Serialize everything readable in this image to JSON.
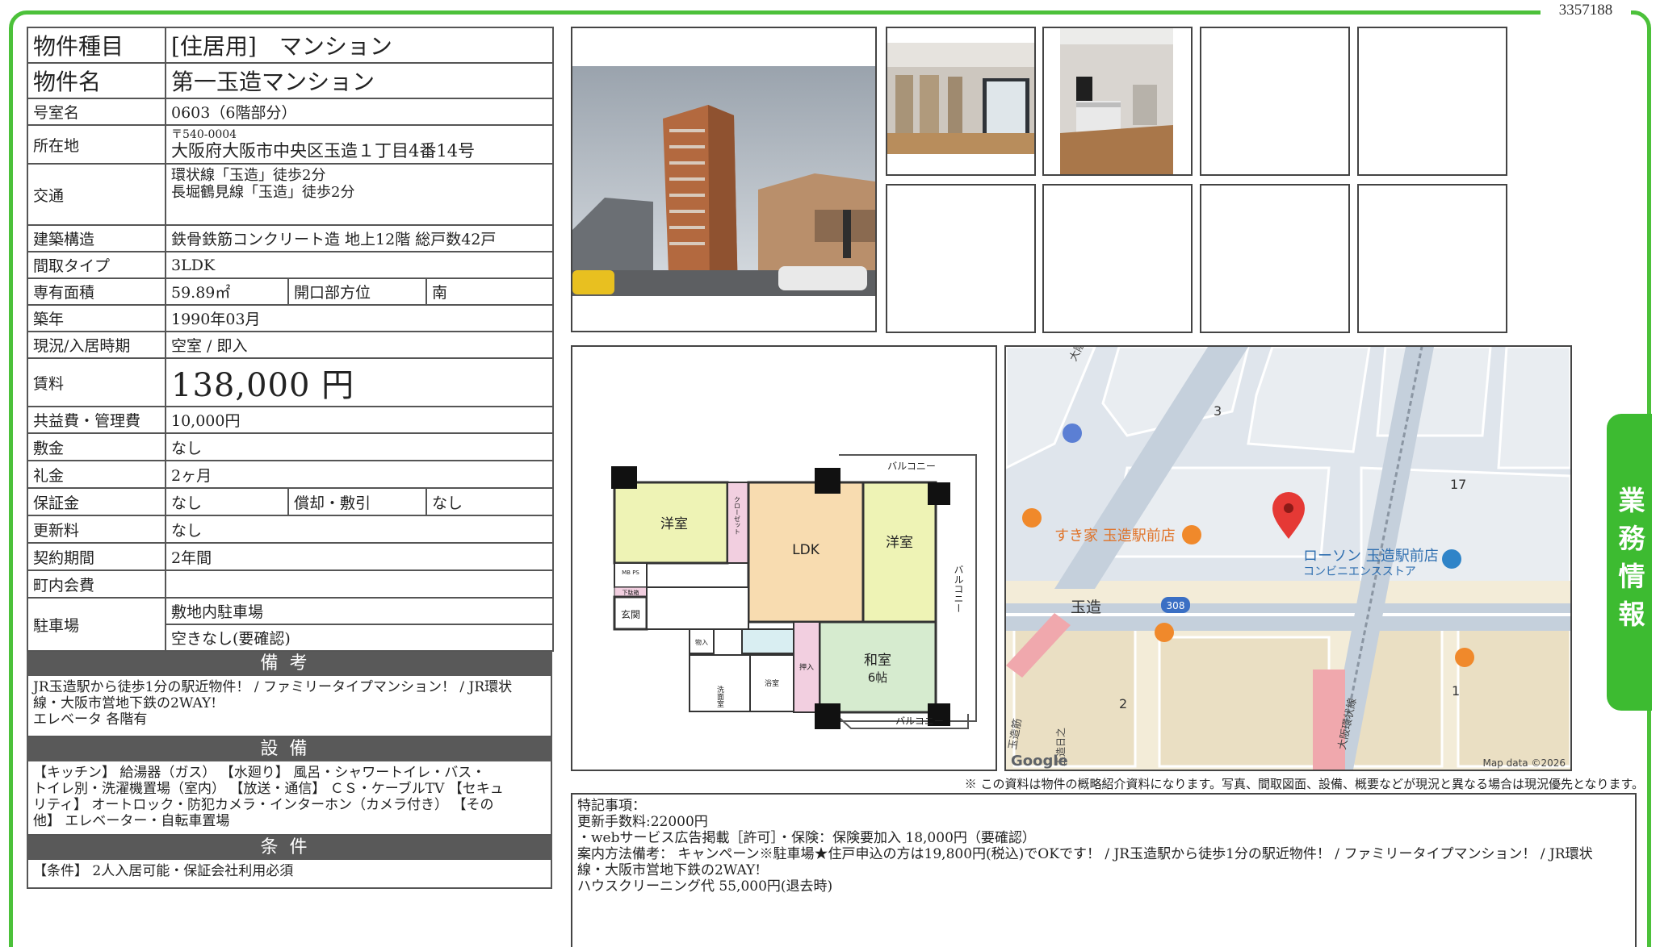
{
  "doc_id": "3357188",
  "side_tab": "業務情報",
  "property": {
    "type_label": "物件種目",
    "type_value": "[住居用]　マンション",
    "name_label": "物件名",
    "name_value": "第一玉造マンション",
    "room_label": "号室名",
    "room_value": "0603（6階部分）",
    "address_label": "所在地",
    "zip": "〒540-0004",
    "address": "大阪府大阪市中央区玉造１丁目4番14号",
    "transport_label": "交通",
    "transport_1": "環状線「玉造」徒歩2分",
    "transport_2": "長堀鶴見線「玉造」徒歩2分",
    "structure_label": "建築構造",
    "structure_value": "鉄骨鉄筋コンクリート造 地上12階 総戸数42戸",
    "layout_label": "間取タイプ",
    "layout_value": "3LDK",
    "area_label": "専有面積",
    "area_value": "59.89㎡",
    "direction_label": "開口部方位",
    "direction_value": "南",
    "built_label": "築年",
    "built_value": "1990年03月",
    "status_label": "現況/入居時期",
    "status_value": "空室 / 即入",
    "rent_label": "賃料",
    "rent_value": "138,000 円",
    "fee_label": "共益費・管理費",
    "fee_value": "10,000円",
    "deposit_label": "敷金",
    "deposit_value": "なし",
    "key_money_label": "礼金",
    "key_money_value": "2ヶ月",
    "guarantee_label": "保証金",
    "guarantee_value": "なし",
    "amortization_label": "償却・敷引",
    "amortization_value": "なし",
    "renewal_label": "更新料",
    "renewal_value": "なし",
    "contract_label": "契約期間",
    "contract_value": "2年間",
    "community_label": "町内会費",
    "community_value": "",
    "parking_label": "駐車場",
    "parking_1": "敷地内駐車場",
    "parking_2": "空きなし(要確認)"
  },
  "notes_section": {
    "title": "備考",
    "line_1": "JR玉造駅から徒歩1分の駅近物件！ / ファミリータイプマンション！ / JR環状",
    "line_2": "線・大阪市営地下鉄の2WAY!",
    "line_3": "エレベータ 各階有"
  },
  "equipment_section": {
    "title": "設備",
    "line_1": "【キッチン】 給湯器（ガス） 【水廻り】 風呂・シャワートイレ・バス・",
    "line_2": "トイレ別・洗濯機置場（室内） 【放送・通信】 ＣＳ・ケーブルTV 【セキュ",
    "line_3": "リティ】 オートロック・防犯カメラ・インターホン（カメラ付き） 【その",
    "line_4": "他】 エレベーター・自転車置場"
  },
  "conditions_section": {
    "title": "条件",
    "line_1": "【条件】 2人入居可能・保証会社利用必須"
  },
  "floorplan": {
    "rooms": {
      "western_1": "洋室",
      "western_2": "洋室",
      "ldk": "LDK",
      "japanese": "和室",
      "japanese_size": "6帖",
      "entrance": "玄関",
      "closet": "クローゼット",
      "balcony_top": "バルコニー",
      "balcony_side": "バルコニー",
      "balcony_bottom": "バルコニー",
      "washroom": "洗面室",
      "bath": "浴室",
      "storage": "物入",
      "oshiire": "押入",
      "shoe": "下駄箱",
      "mbps": "MB PS"
    }
  },
  "map": {
    "labels": {
      "store_1": "すき家 玉造駅前店",
      "store_2": "ローソン 玉造駅前店",
      "store_2_sub": "コンビニエンスストア",
      "station": "玉造",
      "route_no": "308",
      "line_label_1": "大阪メトロ長堀鶴見緑地線",
      "line_label_2": "大阪環状線",
      "street_1": "玉造筋",
      "street_2": "玉造日之",
      "block_3": "3",
      "block_17": "17",
      "block_2": "2",
      "block_1": "1",
      "google": "Google",
      "map_data": "Map data ©2026"
    }
  },
  "notice": "※ この資料は物件の概略紹介資料になります。写真、間取図面、設備、概要などが現況と異なる場合は現況優先となります。",
  "remarks": {
    "line_1": "特記事項：",
    "line_2": "更新手数料:22000円",
    "line_3": "・webサービス広告掲載［許可］・保険：保険要加入 18,000円（要確認）",
    "line_4": "案内方法備考： キャンペーン※駐車場★住戸申込の方は19,800円(税込)でOKです！ / JR玉造駅から徒歩1分の駅近物件！ / ファミリータイプマンション！ / JR環状",
    "line_5": "線・大阪市営地下鉄の2WAY!",
    "line_6": "ハウスクリーニング代 55,000円(退去時)"
  },
  "colors": {
    "frame_green": "#4cc13a",
    "section_gray": "#595959",
    "western_room": "#eef3b5",
    "ldk_room": "#f8dcb0",
    "japanese_room": "#d6ebcf",
    "closet_pink": "#f2cfe0",
    "map_pin": "#e53935"
  }
}
